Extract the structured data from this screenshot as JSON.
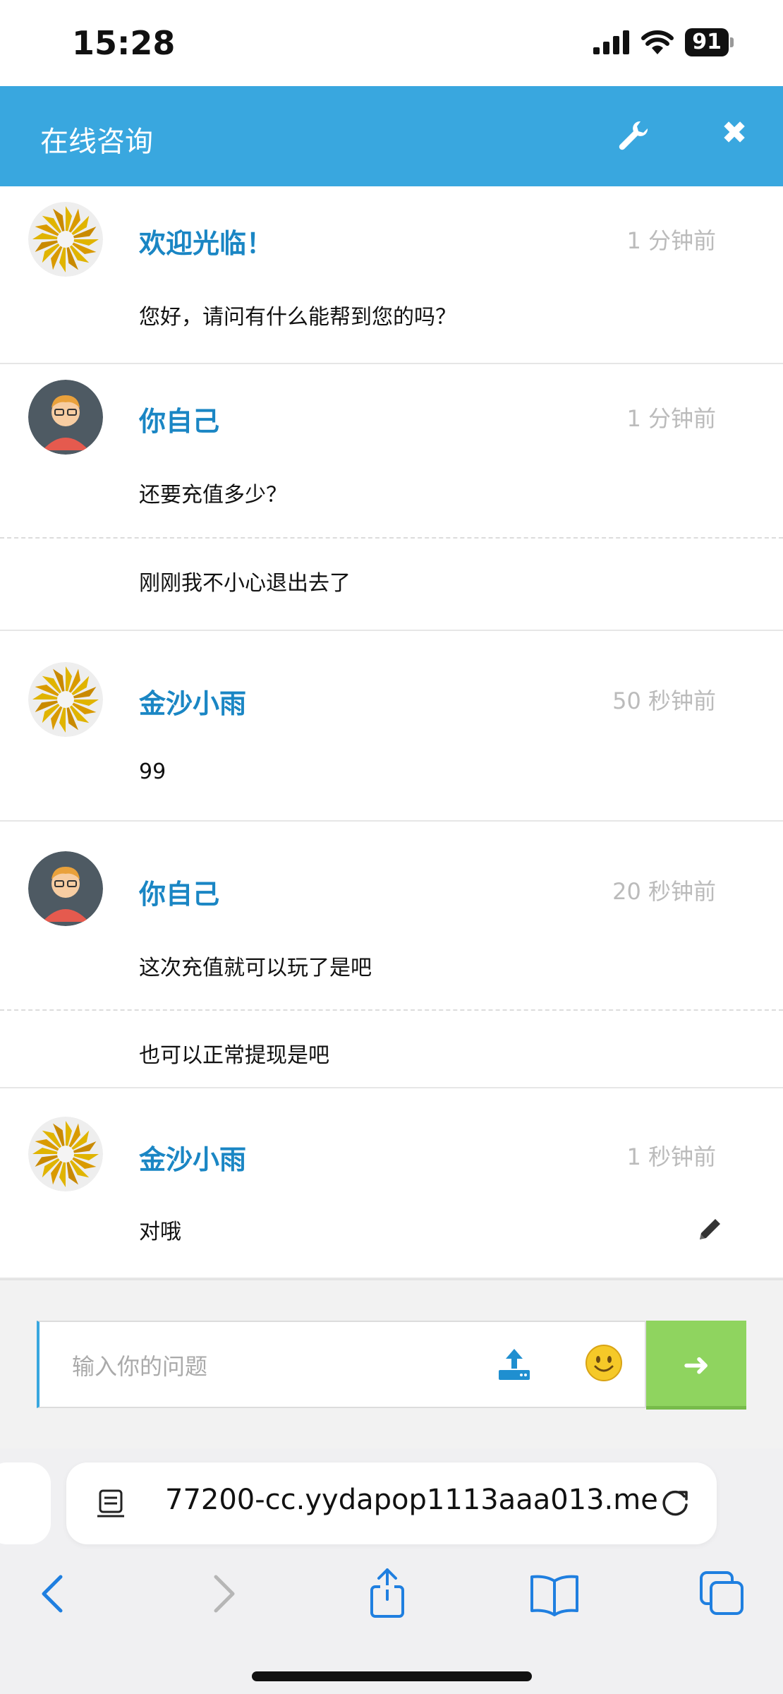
{
  "status_bar": {
    "time": "15:28",
    "battery": "91"
  },
  "header": {
    "title": "在线咨询",
    "wrench_icon": "wrench-icon",
    "close_icon": "close-icon",
    "close_glyph": "✖"
  },
  "messages": [
    {
      "sender": "欢迎光临！",
      "time": "1 分钟前",
      "avatar": "sunburst",
      "lines": [
        "您好，请问有什么能帮到您的吗？"
      ]
    },
    {
      "sender": "你自己",
      "time": "1 分钟前",
      "avatar": "person",
      "lines": [
        "还要充值多少？",
        "刚刚我不小心退出去了"
      ]
    },
    {
      "sender": "金沙小雨",
      "time": "50 秒钟前",
      "avatar": "sunburst",
      "lines": [
        "99"
      ]
    },
    {
      "sender": "你自己",
      "time": "20 秒钟前",
      "avatar": "person",
      "lines": [
        "这次充值就可以玩了是吧",
        "也可以正常提现是吧"
      ]
    },
    {
      "sender": "金沙小雨",
      "time": "1 秒钟前",
      "avatar": "sunburst",
      "lines": [
        "对哦"
      ]
    }
  ],
  "input": {
    "placeholder": "输入你的问题",
    "send_glyph": "➜"
  },
  "browser": {
    "url": "77200-cc.yydapop1113aaa013.me"
  },
  "colors": {
    "header": "#39a7df",
    "sender": "#1a86c4",
    "send": "#8fd45f"
  }
}
